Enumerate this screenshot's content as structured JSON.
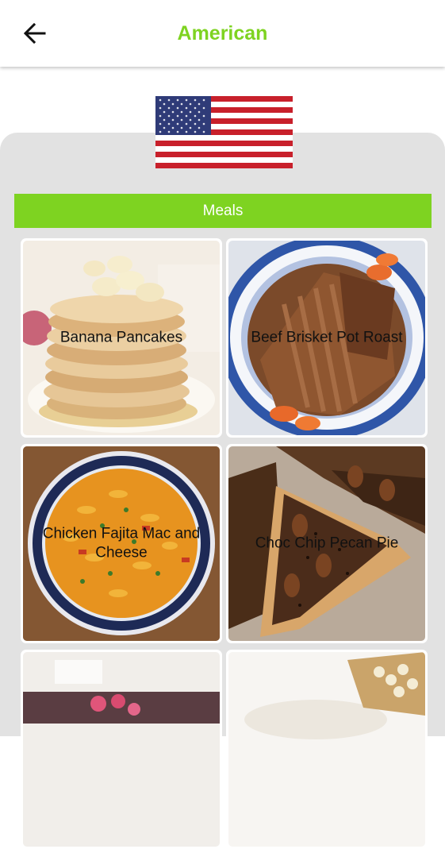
{
  "appbar": {
    "title": "American",
    "back_icon": "arrow-left-icon",
    "title_color": "#7ed321"
  },
  "section": {
    "label": "Meals",
    "color": "#7ed321"
  },
  "meals": [
    {
      "name": "Banana Pancakes"
    },
    {
      "name": "Beef Brisket Pot Roast"
    },
    {
      "name": "Chicken Fajita Mac and Cheese"
    },
    {
      "name": "Choc Chip Pecan Pie"
    },
    {
      "name": ""
    },
    {
      "name": ""
    }
  ]
}
